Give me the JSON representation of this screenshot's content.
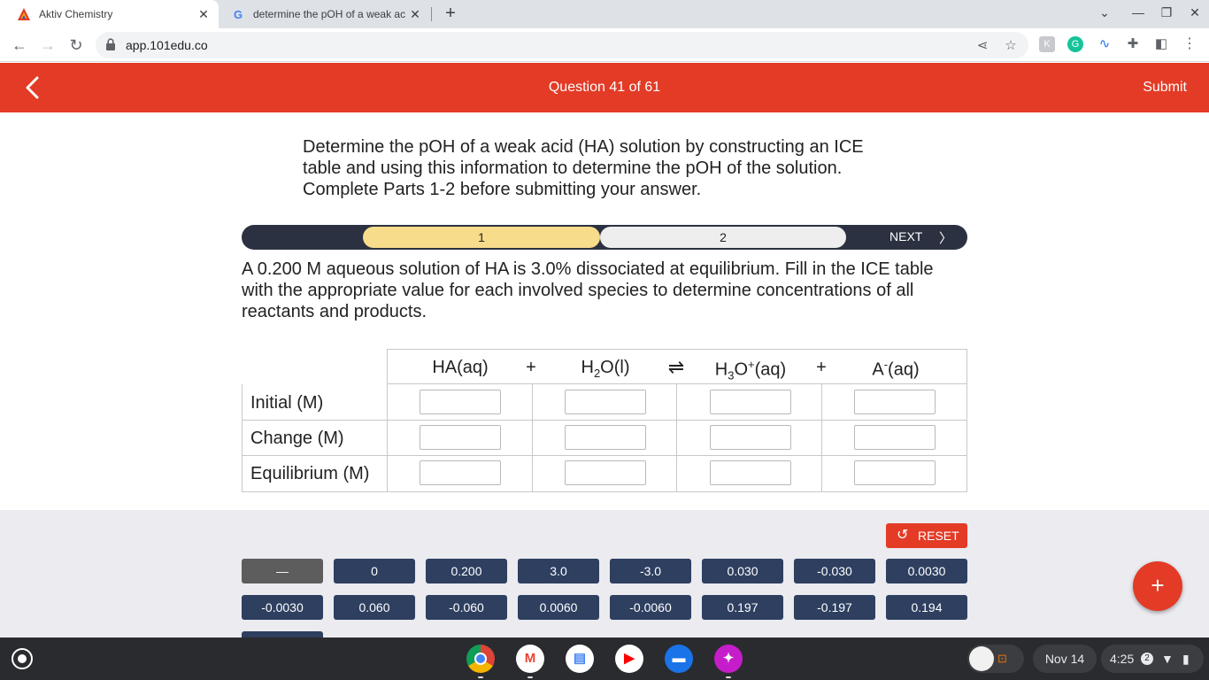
{
  "browser": {
    "tabs": [
      {
        "title": "Aktiv Chemistry",
        "active": true
      },
      {
        "title": "determine the pOH of a weak ac",
        "active": false
      }
    ],
    "url": "app.101edu.co"
  },
  "header": {
    "question_label": "Question 41 of 61",
    "submit_label": "Submit"
  },
  "intro": "Determine the pOH of a weak acid (HA) solution by constructing an ICE table and using this information to determine the pOH of the solution. Complete Parts 1-2 before submitting your answer.",
  "progress": {
    "step1": "1",
    "step2": "2",
    "next_label": "NEXT"
  },
  "question": "A 0.200 M aqueous solution of HA is 3.0% dissociated at equilibrium. Fill in the ICE table with the appropriate value for each involved species to determine concentrations of all reactants and products.",
  "ice_table": {
    "species": {
      "ha": "HA(aq)",
      "plus1": "+",
      "arrow": "⇌",
      "plus2": "+"
    },
    "rows": [
      "Initial (M)",
      "Change (M)",
      "Equilibrium (M)"
    ]
  },
  "palette": {
    "reset_label": "RESET",
    "tiles_row1": [
      "—",
      "0",
      "0.200",
      "3.0",
      "-3.0",
      "0.030",
      "-0.030",
      "0.0030"
    ],
    "tiles_row2": [
      "-0.0030",
      "0.060",
      "-0.060",
      "0.0060",
      "-0.0060",
      "0.197",
      "-0.197",
      "0.194"
    ]
  },
  "shelf": {
    "date": "Nov 14",
    "time": "4:25",
    "notification_count": "2"
  },
  "colors": {
    "brand_red": "#e33b26",
    "tile_navy": "#2e3f60",
    "progress_active": "#f6dc8b"
  }
}
